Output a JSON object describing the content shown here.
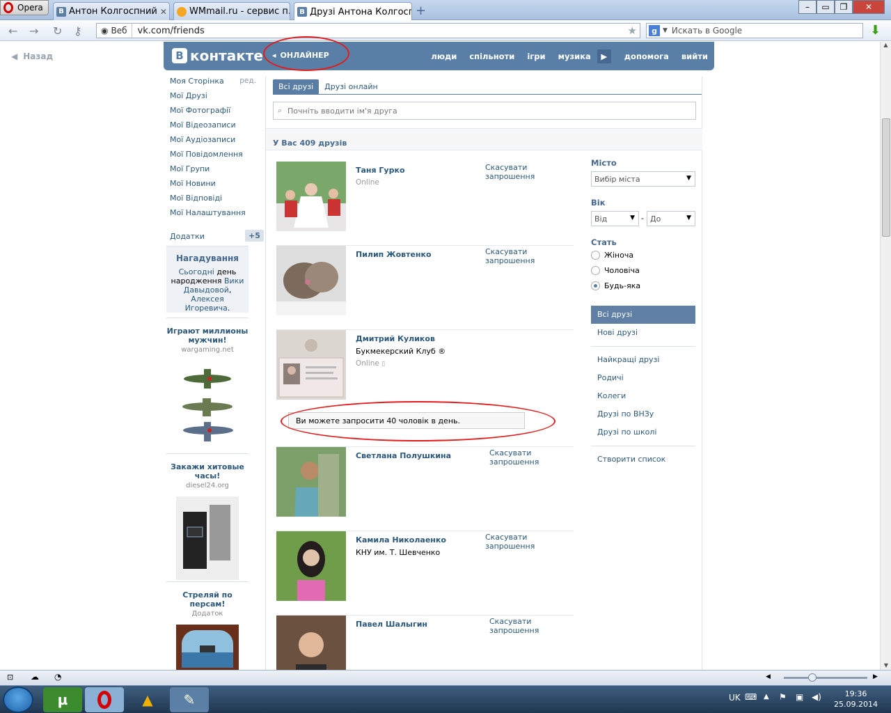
{
  "browser": {
    "menu_label": "Opera",
    "tabs": [
      {
        "label": "Антон Колгоспний"
      },
      {
        "label": "WMmail.ru - сервис п..."
      },
      {
        "label": "Друзі Антона Колгосп..."
      }
    ],
    "addr_prefix": "Веб",
    "url": "vk.com/friends",
    "search_placeholder": "Искать в Google"
  },
  "page": {
    "back": "Назад",
    "logo": "контакте",
    "onliner": "ОНЛАЙНЕР",
    "topmenu": [
      "люди",
      "спільноти",
      "ігри",
      "музика",
      "допомога",
      "вийти"
    ]
  },
  "leftnav": {
    "items": [
      "Моя Сторінка",
      "Мої Друзі",
      "Мої Фотографії",
      "Мої Відеозаписи",
      "Мої Аудіозаписи",
      "Мої Повідомлення",
      "Мої Групи",
      "Мої Новини",
      "Мої Відповіді",
      "Мої Налаштування"
    ],
    "edit": "ред.",
    "addons": "Додатки",
    "addons_badge": "+5"
  },
  "reminder": {
    "title": "Нагадування",
    "t1": "Сьогодні",
    "t2": " день народження ",
    "t3": "Вики Давыдовой",
    "t4": ", ",
    "t5": "Алексея Игоревича",
    "t6": "."
  },
  "ads": [
    {
      "title": "Играют миллионы мужчин!",
      "sub": "wargaming.net"
    },
    {
      "title": "Закажи хитовые часы!",
      "sub": "diesel24.org"
    },
    {
      "title": "Стреляй по персам!",
      "sub": "Додаток"
    }
  ],
  "main": {
    "tab_all": "Всі друзі",
    "tab_online": "Друзі онлайн",
    "search_placeholder": "Почніть вводити ім'я друга",
    "count": "У Вас 409 друзів",
    "limit_notice": "Ви можете запросити 40 чоловік в день."
  },
  "friends": [
    {
      "name": "Таня Гурко",
      "status": "Online",
      "sub": "",
      "action": "Скасувати запрошення"
    },
    {
      "name": "Пилип Жовтенко",
      "status": "",
      "sub": "",
      "action": "Скасувати запрошення"
    },
    {
      "name": "Дмитрий Куликов",
      "status": "Online",
      "sub": "Букмекерский Клуб ®",
      "action": ""
    },
    {
      "name": "Светлана Полушкина",
      "status": "",
      "sub": "",
      "action": "Скасувати запрошення"
    },
    {
      "name": "Камила Николаенко",
      "status": "",
      "sub": "КНУ им. Т. Шевченко",
      "action": "Скасувати запрошення"
    },
    {
      "name": "Павел Шалыгин",
      "status": "",
      "sub": "",
      "action": "Скасувати запрошення"
    }
  ],
  "filter": {
    "city_label": "Місто",
    "city_value": "Вибір міста",
    "age_label": "Вік",
    "age_from": "Від",
    "age_to": "До",
    "age_dash": "-",
    "sex_label": "Стать",
    "sex": [
      "Жіноча",
      "Чоловіча",
      "Будь-яка"
    ],
    "lists": [
      "Всі друзі",
      "Нові друзі",
      "Найкращі друзі",
      "Родичі",
      "Колеги",
      "Друзі по ВНЗу",
      "Друзі по школі",
      "Створити список"
    ]
  },
  "taskbar": {
    "lang": "UK",
    "time": "19:36",
    "date": "25.09.2014"
  }
}
